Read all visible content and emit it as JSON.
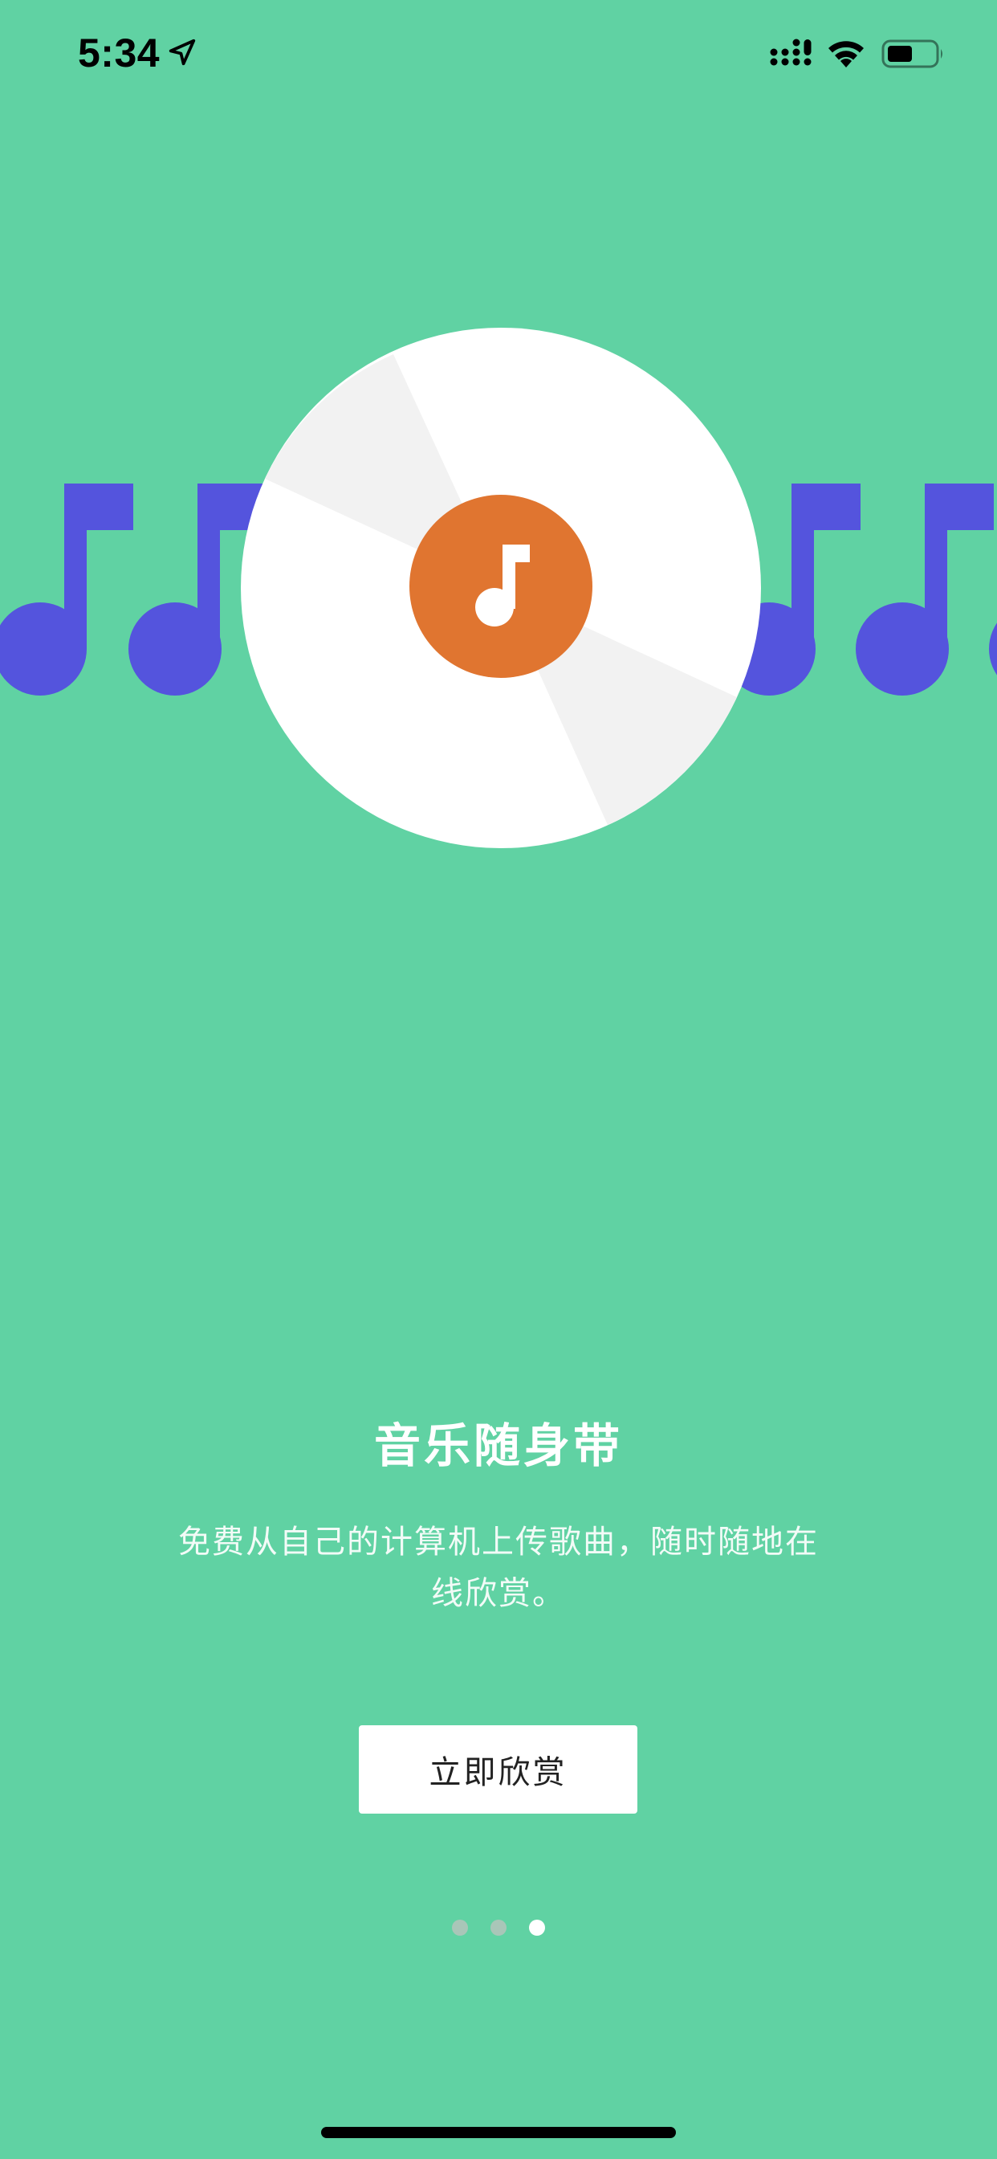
{
  "status_bar": {
    "time": "5:34",
    "icons": [
      "location-arrow-icon",
      "cellular-signal-icon",
      "wifi-icon",
      "battery-icon"
    ]
  },
  "hero": {
    "icons": [
      "music-note-icon",
      "vinyl-disc-icon",
      "music-note-icon"
    ],
    "colors": {
      "background": "#60D2A3",
      "notes": "#5454DD",
      "disc": "#FFFFFF",
      "disc_shade": "#F2F2F2",
      "label": "#E07530"
    }
  },
  "onboarding": {
    "title": "音乐随身带",
    "description": "免费从自己的计算机上传歌曲，随时随地在线欣赏。",
    "button_label": "立即欣赏"
  },
  "pager": {
    "total_pages": 3,
    "current_page": 3
  }
}
